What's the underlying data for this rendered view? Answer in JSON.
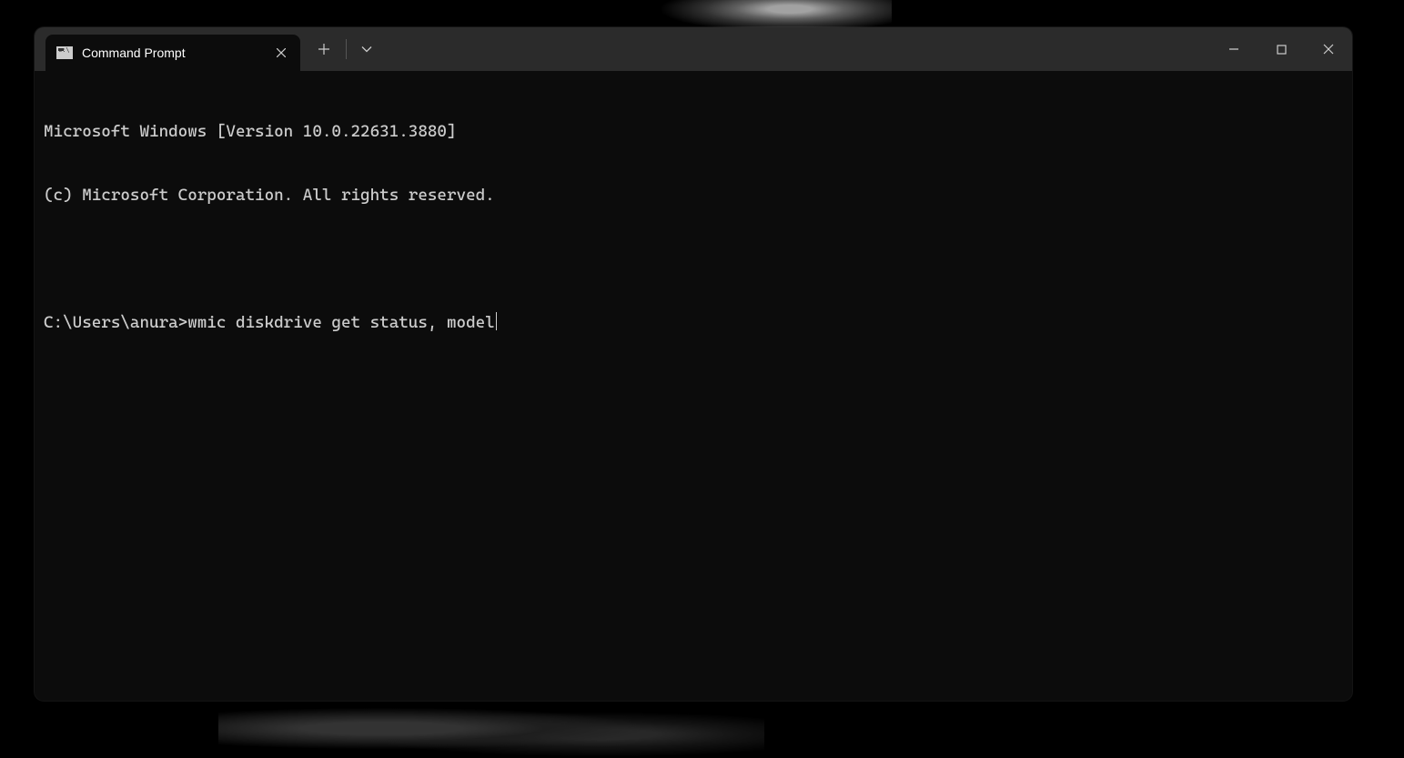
{
  "tab": {
    "title": "Command Prompt"
  },
  "terminal": {
    "header_line1": "Microsoft Windows [Version 10.0.22631.3880]",
    "header_line2": "(c) Microsoft Corporation. All rights reserved.",
    "prompt": "C:\\Users\\anura>",
    "command": "wmic diskdrive get status, model"
  }
}
